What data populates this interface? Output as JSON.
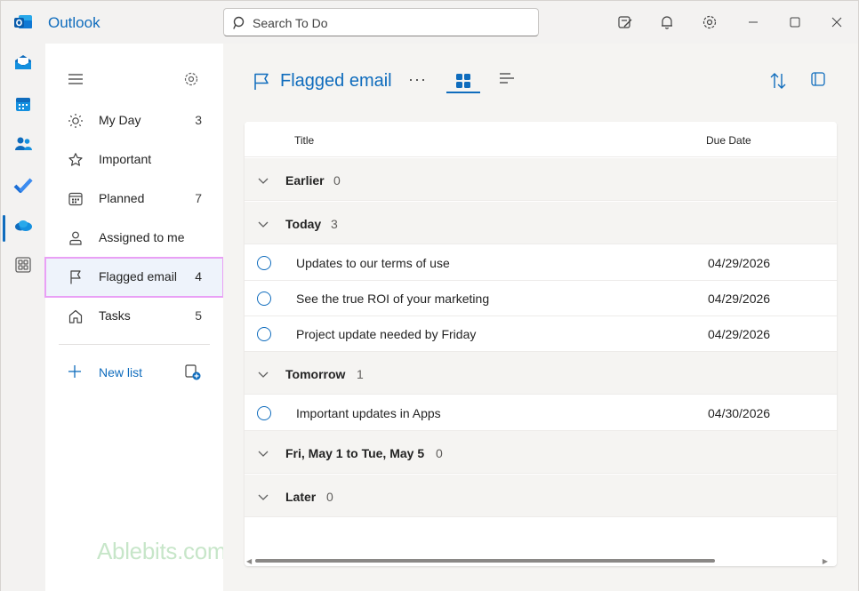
{
  "app": {
    "name": "Outlook"
  },
  "search": {
    "placeholder": "Search To Do"
  },
  "sidebar": {
    "items": [
      {
        "label": "My Day",
        "count": "3",
        "icon": "sun-icon"
      },
      {
        "label": "Important",
        "count": "",
        "icon": "star-icon"
      },
      {
        "label": "Planned",
        "count": "7",
        "icon": "calendar-icon"
      },
      {
        "label": "Assigned to me",
        "count": "",
        "icon": "person-icon"
      },
      {
        "label": "Flagged email",
        "count": "4",
        "icon": "flag-icon"
      },
      {
        "label": "Tasks",
        "count": "5",
        "icon": "home-icon"
      }
    ],
    "new_list": "New list",
    "watermark": "Ablebits.com"
  },
  "main": {
    "title": "Flagged email",
    "more": "···",
    "columns": {
      "title": "Title",
      "due": "Due Date"
    },
    "groups": [
      {
        "name": "Earlier",
        "count": "0"
      },
      {
        "name": "Today",
        "count": "3"
      },
      {
        "name": "Tomorrow",
        "count": "1"
      },
      {
        "name": "Fri, May 1 to Tue, May 5",
        "count": "0"
      },
      {
        "name": "Later",
        "count": "0"
      }
    ],
    "tasks": [
      {
        "title": "Updates to our terms of use",
        "due": "04/29/2026"
      },
      {
        "title": "See the true ROI of your marketing",
        "due": "04/29/2026"
      },
      {
        "title": "Project update needed by Friday",
        "due": "04/29/2026"
      },
      {
        "title": "Important updates in Apps",
        "due": "04/30/2026"
      }
    ]
  },
  "colors": {
    "accent": "#0f6cbd",
    "selected_outline": "#e9a0f5"
  }
}
